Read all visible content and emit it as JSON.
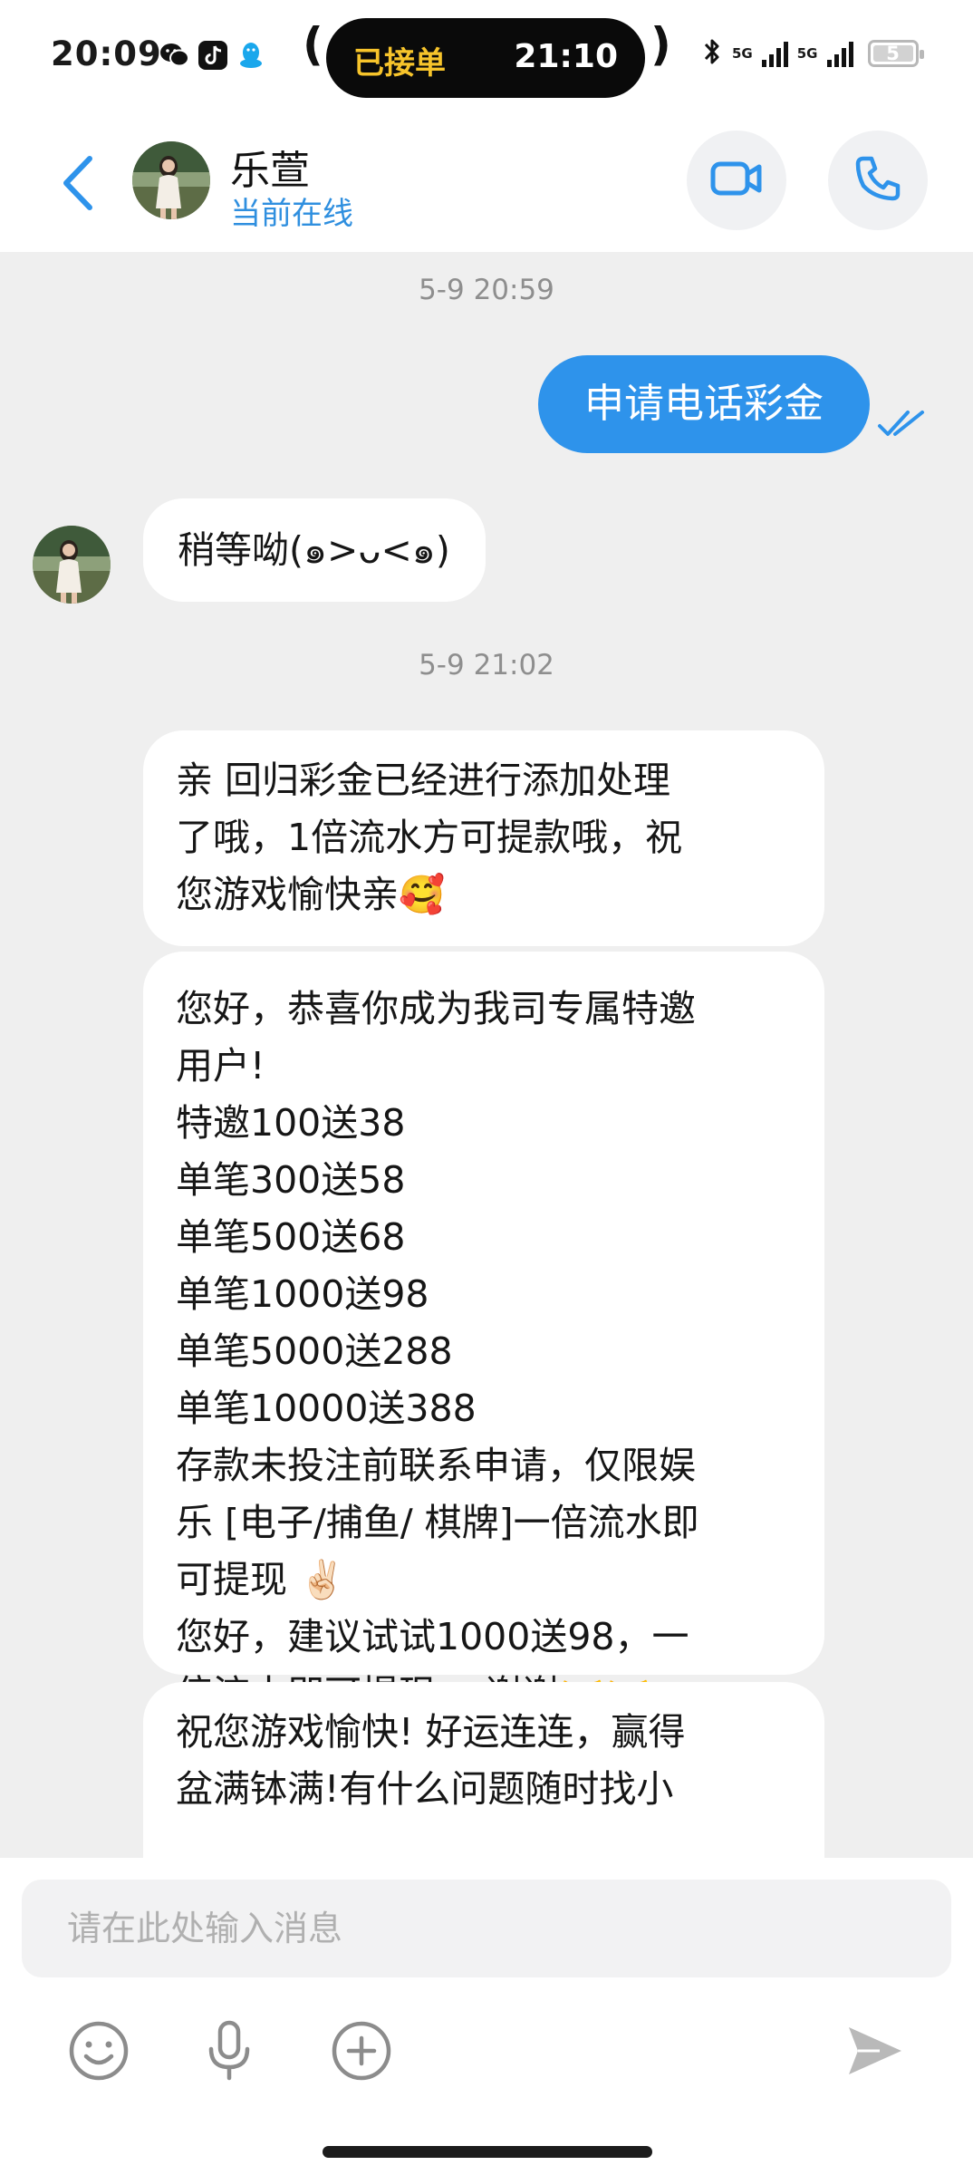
{
  "status_bar": {
    "time": "20:09",
    "app_icons": [
      "wechat-icon",
      "tiktok-icon",
      "qq-icon"
    ],
    "island": {
      "label": "已接单",
      "time": "21:10"
    },
    "network": [
      "5G",
      "5G"
    ],
    "battery": "5"
  },
  "header": {
    "contact_name": "乐萱",
    "status": "当前在线",
    "icons": {
      "back": "chevron-left-icon",
      "video": "video-camera-icon",
      "call": "phone-icon"
    }
  },
  "messages": [
    {
      "type": "timestamp",
      "text": "5-9 20:59"
    },
    {
      "type": "outgoing",
      "text": "申请电话彩金",
      "read": true
    },
    {
      "type": "incoming",
      "text": "稍等呦(๑>ᴗ<๑)"
    },
    {
      "type": "timestamp",
      "text": "5-9 21:02"
    },
    {
      "type": "incoming",
      "text": "亲 回归彩金已经进行添加处理\n了哦，1倍流水方可提款哦，祝\n您游戏愉快亲🥰"
    },
    {
      "type": "incoming",
      "text": "您好，恭喜你成为我司专属特邀\n用户!\n特邀100送38\n单笔300送58\n单笔500送68\n单笔1000送98\n单笔5000送288\n单笔10000送388\n存款未投注前联系申请，仅限娱\n乐 [电子/捕鱼/ 棋牌]一倍流水即\n可提现 ✌🏻\n您好，建议试试1000送98，一\n倍流水即可提现 ，谢谢🤝🤝"
    },
    {
      "type": "incoming",
      "text": "祝您游戏愉快! 好运连连，赢得\n盆满钵满!有什么问题随时找小"
    }
  ],
  "input": {
    "placeholder": "请在此处输入消息",
    "value": ""
  },
  "toolbar": {
    "emoji": "emoji-icon",
    "voice": "microphone-icon",
    "more": "plus-circle-icon",
    "send": "send-icon"
  },
  "colors": {
    "accent": "#2e93eb",
    "background": "#efefef",
    "bubble_in": "#ffffff",
    "island_label": "#f7c42b"
  }
}
